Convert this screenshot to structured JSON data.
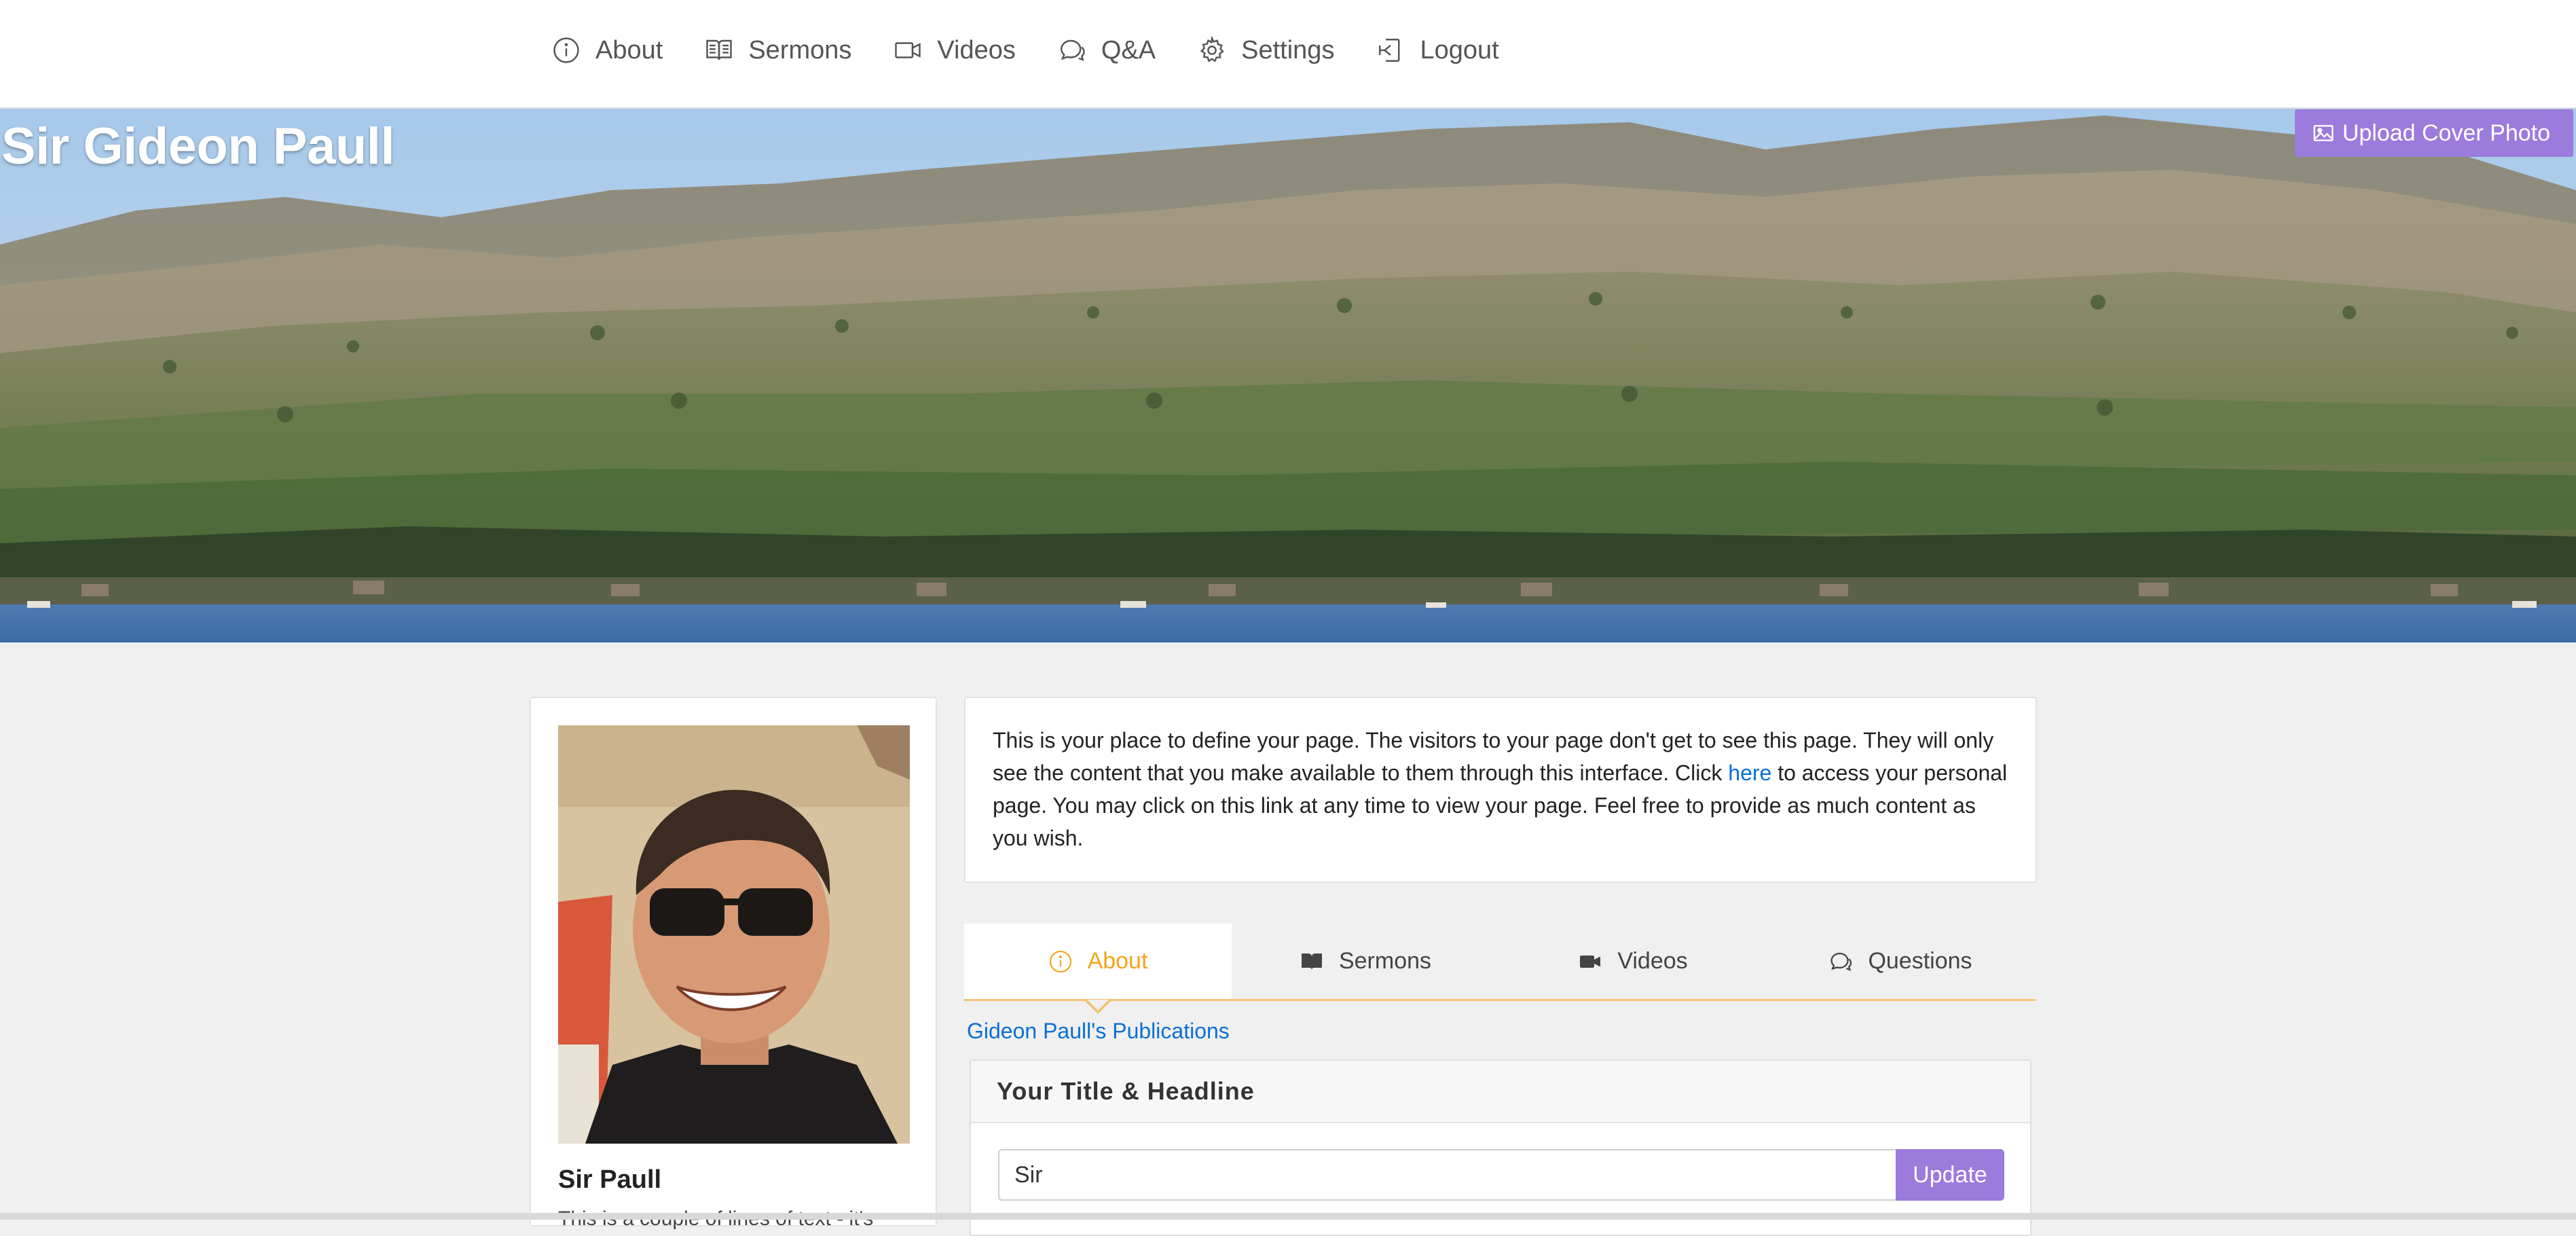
{
  "nav": {
    "items": [
      {
        "label": "About",
        "icon": "info-icon"
      },
      {
        "label": "Sermons",
        "icon": "book-icon"
      },
      {
        "label": "Videos",
        "icon": "video-camera-icon"
      },
      {
        "label": "Q&A",
        "icon": "chat-bubbles-icon"
      },
      {
        "label": "Settings",
        "icon": "gear-icon"
      },
      {
        "label": "Logout",
        "icon": "logout-icon"
      }
    ]
  },
  "cover": {
    "title": "Sir Gideon Paull",
    "upload_label": "Upload Cover Photo",
    "upload_icon": "image-icon"
  },
  "profile": {
    "name": "Sir Paull",
    "bio": "This is a couple of lines of text - it's"
  },
  "info": {
    "text_before": "This is your place to define your page. The visitors to your page don't get to see this page. They will only see the content that you make available to them through this interface. Click ",
    "link": "here",
    "text_after": " to access your personal page. You may click on this link at any time to view your page. Feel free to provide as much content as you wish."
  },
  "tabs": [
    {
      "label": "About",
      "icon": "info-icon",
      "active": true
    },
    {
      "label": "Sermons",
      "icon": "book-icon",
      "active": false
    },
    {
      "label": "Videos",
      "icon": "video-camera-icon",
      "active": false
    },
    {
      "label": "Questions",
      "icon": "chat-bubbles-icon",
      "active": false
    }
  ],
  "publications_link": "Gideon Paull's Publications",
  "headline": {
    "title": "Your Title & Headline",
    "value": "Sir",
    "button": "Update"
  },
  "colors": {
    "accent_purple": "#9b7bdc",
    "tab_active": "#f2a51a",
    "link": "#0a6fd6"
  }
}
